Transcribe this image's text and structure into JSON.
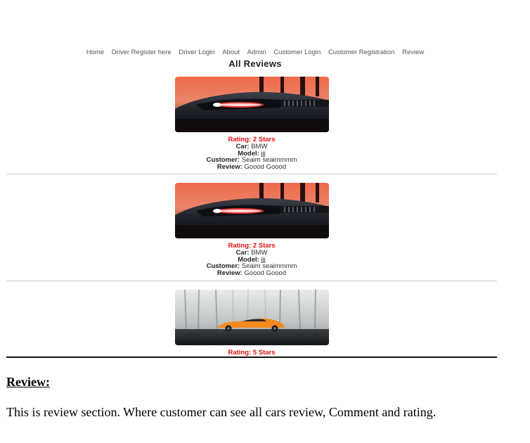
{
  "nav": {
    "items": [
      {
        "label": "Home",
        "name": "nav-home"
      },
      {
        "label": "Driver Register here",
        "name": "nav-driver-register"
      },
      {
        "label": "Driver Login",
        "name": "nav-driver-login"
      },
      {
        "label": "About",
        "name": "nav-about"
      },
      {
        "label": "Admin",
        "name": "nav-admin"
      },
      {
        "label": "Customer Login",
        "name": "nav-customer-login"
      },
      {
        "label": "Customer Registration",
        "name": "nav-customer-registration"
      },
      {
        "label": "Review",
        "name": "nav-review"
      }
    ]
  },
  "page_heading": "All Reviews",
  "labels": {
    "car": "Car:",
    "model": "Model:",
    "customer": "Customer:",
    "review": "Review:"
  },
  "reviews": [
    {
      "rating": "Rating: 2 Stars",
      "car": "BMW",
      "model": "jjj",
      "customer": "Seaim seaimmmm",
      "review": "Goood Goood",
      "image": "bmw-rear-sunset"
    },
    {
      "rating": "Rating: 2 Stars",
      "car": "BMW",
      "model": "jjj",
      "customer": "Seaim seaimmmm",
      "review": "Goood Goood",
      "image": "bmw-rear-sunset"
    },
    {
      "rating": "Rating: 5 Stars",
      "image": "orange-sports-car-misty-forest"
    }
  ],
  "section": {
    "title": "Review:",
    "body": "This is review section. Where customer can see all cars review, Comment and rating."
  },
  "colors": {
    "rating": "#e01010",
    "divider": "#cfcfcf",
    "rule": "#111111"
  }
}
